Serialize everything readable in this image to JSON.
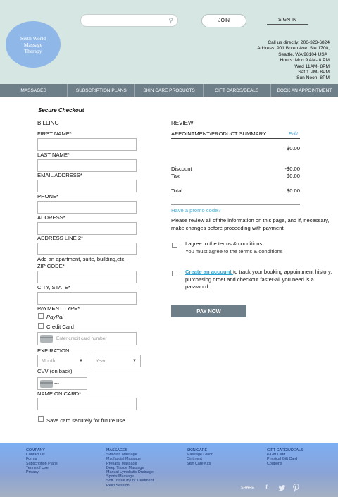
{
  "header": {
    "logo_lines": [
      "Sixth World",
      "Massage",
      "Therapy"
    ],
    "search_placeholder": "",
    "join_label": "JOIN",
    "signin_label": "SIGN IN",
    "contact_lines": [
      "Call us directly: 206-323-6824",
      "Address: 901 Boren Ave. Ste 1700,",
      "Seattle, WA 98104 USA",
      "Hours: Mon 9 AM- 8 PM",
      "Wed 11AM- 8PM",
      "Sat    1 PM- 8PM",
      "Sun   Noon- 8PM"
    ]
  },
  "nav": [
    "MASSAGES",
    "SUBSCRIPTION PLANS",
    "SKIN CARE PRODUCTS",
    "GIFT CARDS/DEALS",
    "BOOK AN APPOINTMENT"
  ],
  "checkout": {
    "title": "Secure Checkout",
    "billing_heading": "BILLING",
    "fields": {
      "first_name": "FIRST NAME*",
      "last_name": "LAST NAME*",
      "email": "EMAIL ADDRESS*",
      "phone": "PHONE*",
      "address": "ADDRESS*",
      "address2": "ADDRESS LINE 2*",
      "address2_note": "Add an apartment, suite, building,etc.",
      "zip": "ZIP CODE*",
      "city_state": "CITY, STATE*"
    },
    "payment_type": "PAYMENT TYPE*",
    "paypal": "PayPal",
    "credit_card": "Credit Card",
    "cc_placeholder": "Enter credit card number",
    "expiration": "EXPIRATION",
    "month": "Month",
    "year": "Year",
    "cvv_label": "CVV (on back)",
    "cvv_value": "---",
    "name_on_card": "NAME ON CARD*",
    "save_card": "Save card securely for future use"
  },
  "review": {
    "heading": "REVIEW",
    "summary_heading": "APPOINTMENT/PRODUCT SUMMARY",
    "edit": "Edit",
    "subtotal": "$0.00",
    "discount_label": "Discount",
    "discount": "-$0.00",
    "tax_label": "Tax",
    "tax": "$0.00",
    "total_label": "Total",
    "total": "$0.00",
    "promo": "Have a promo code?",
    "review_text": "Please review all of the information on this page, and if, necessary, make changes before proceeding with payment.",
    "terms_line1": "I agree to the terms & conditions.",
    "terms_line2": "You must agree to the terms & conditions",
    "create_account_link": "Create an account ",
    "create_account_text": "to track your booking appointment history, purchasing order and checkout faster-all you need is a password.",
    "pay_now": "PAY NOW"
  },
  "footer": {
    "company": [
      "COMPANY",
      "Contact Us",
      "Forms",
      "Subscription Plans",
      "Terms of Use",
      "Privacy"
    ],
    "massages": [
      "MASSAGES",
      "Swedish Massage",
      "Myofascial Massage",
      "Prenatal Massage",
      "Deep Tissue Massage",
      "Manual Lymphatic Drainage",
      "Sports Massage",
      "Soft Tissue Injury Treatment",
      "Reiki Session"
    ],
    "skin_care": [
      "SKIN CARE",
      "Massage Lotion",
      "Ointment",
      "Skin Care Kits"
    ],
    "gift_cards": [
      "GIFT CARDS/DEALS",
      "e-Gift Card",
      "Physical Gift Card",
      "Coupons"
    ],
    "share": "SHARE"
  }
}
